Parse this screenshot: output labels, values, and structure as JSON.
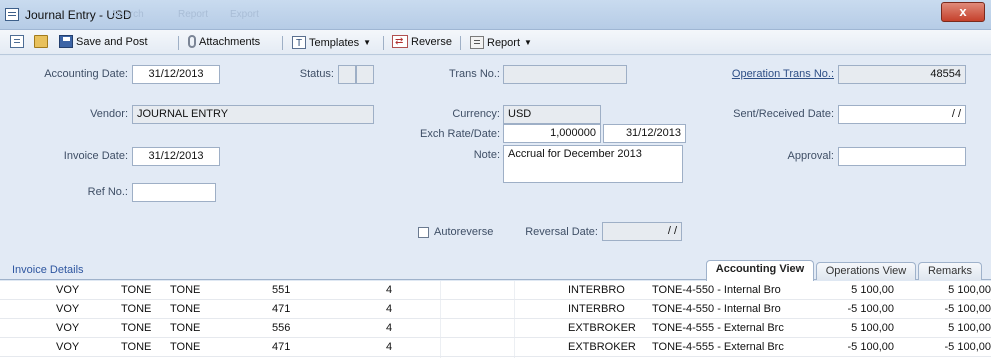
{
  "window": {
    "title": "Journal Entry - USD",
    "ghost_menu": [
      "Search",
      "Report",
      "Export"
    ],
    "close_label": "x"
  },
  "toolbar": {
    "save_post_label": "Save and Post",
    "attachments_label": "Attachments",
    "templates_label": "Templates",
    "reverse_label": "Reverse",
    "report_label": "Report"
  },
  "form": {
    "accounting_date_label": "Accounting Date:",
    "accounting_date": "31/12/2013",
    "status_label": "Status:",
    "trans_no_label": "Trans No.:",
    "trans_no": "",
    "operation_trans_no_label": "Operation Trans No.:",
    "operation_trans_no": "48554",
    "vendor_label": "Vendor:",
    "vendor": "JOURNAL ENTRY",
    "currency_label": "Currency:",
    "currency": "USD",
    "sent_received_label": "Sent/Received Date:",
    "sent_received_date": "/ /",
    "exch_rate_label": "Exch Rate/Date:",
    "exch_rate": "1,000000",
    "exch_date": "31/12/2013",
    "invoice_date_label": "Invoice Date:",
    "invoice_date": "31/12/2013",
    "note_label": "Note:",
    "note": "Accrual for December 2013",
    "approval_label": "Approval:",
    "approval": "",
    "ref_no_label": "Ref No.:",
    "ref_no": "",
    "autoreverse_label": "Autoreverse",
    "reversal_date_label": "Reversal Date:",
    "reversal_date": "/ /"
  },
  "details": {
    "title": "Invoice Details",
    "tabs": [
      "Accounting View",
      "Operations View",
      "Remarks"
    ],
    "active_tab": 0
  },
  "rows": [
    {
      "type": "VOY",
      "c2": "TONE",
      "c3": "TONE",
      "code": "551",
      "qty": "4",
      "ledger": "INTERBRO",
      "desc": "TONE-4-550 - Internal Bro",
      "amount": "5 100,00",
      "total": "5 100,00"
    },
    {
      "type": "VOY",
      "c2": "TONE",
      "c3": "TONE",
      "code": "471",
      "qty": "4",
      "ledger": "INTERBRO",
      "desc": "TONE-4-550 - Internal Bro",
      "amount": "-5 100,00",
      "total": "-5 100,00"
    },
    {
      "type": "VOY",
      "c2": "TONE",
      "c3": "TONE",
      "code": "556",
      "qty": "4",
      "ledger": "EXTBROKER",
      "desc": "TONE-4-555 - External Brc",
      "amount": "5 100,00",
      "total": "5 100,00"
    },
    {
      "type": "VOY",
      "c2": "TONE",
      "c3": "TONE",
      "code": "471",
      "qty": "4",
      "ledger": "EXTBROKER",
      "desc": "TONE-4-555 - External Brc",
      "amount": "-5 100,00",
      "total": "-5 100,00"
    }
  ]
}
